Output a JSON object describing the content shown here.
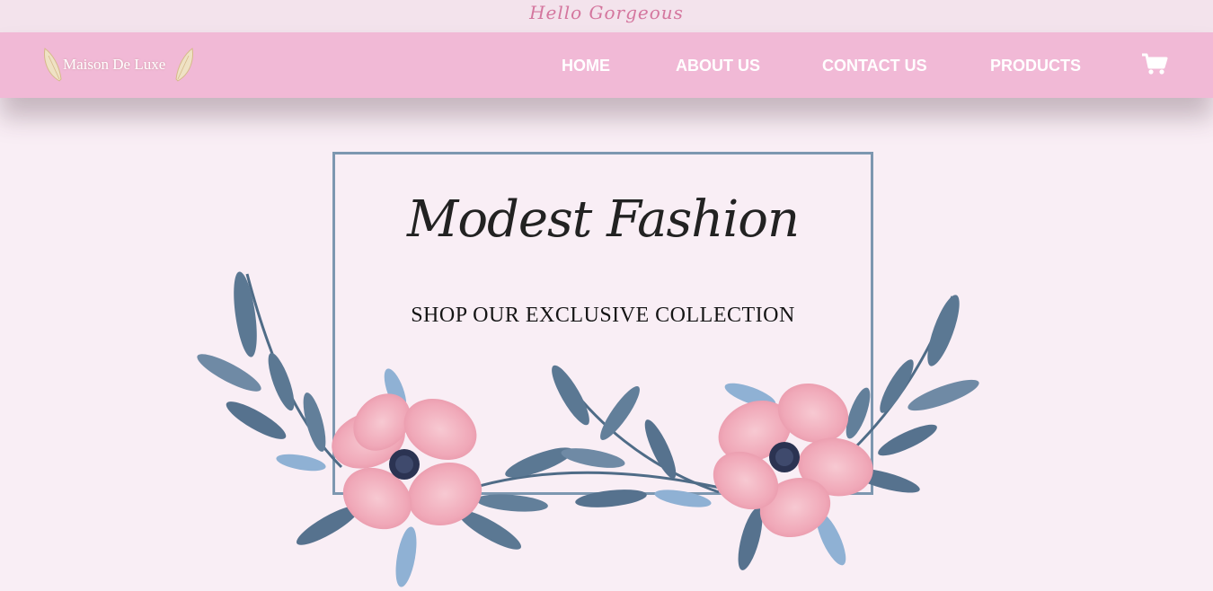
{
  "greeting": "Hello Gorgeous",
  "logo": {
    "text": "Maison De Luxe"
  },
  "nav": {
    "items": [
      {
        "label": "HOME"
      },
      {
        "label": "ABOUT US"
      },
      {
        "label": "CONTACT US"
      },
      {
        "label": "PRODUCTS"
      }
    ],
    "cart_icon": "shopping-cart-icon"
  },
  "hero": {
    "title": "Modest Fashion",
    "subtitle": "SHOP OUR EXCLUSIVE COLLECTION"
  },
  "colors": {
    "page_background": "#f9eef5",
    "navbar": "#f1b9d6",
    "frame_border": "#7d97b0",
    "flower_pink": "#f0a8b8",
    "leaf_blue": "#5b7893"
  }
}
